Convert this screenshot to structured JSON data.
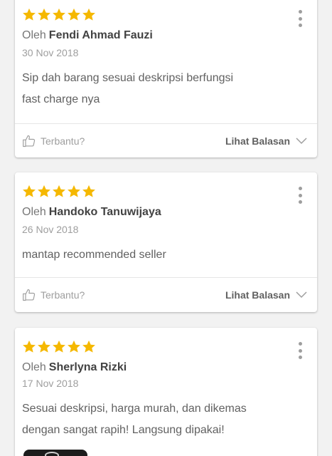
{
  "reviews": [
    {
      "rating": 5,
      "by_prefix": "Oleh",
      "reviewer": "Fendi Ahmad Fauzi",
      "date": "30 Nov 2018",
      "text_lines": [
        "Sip dah barang sesuai deskripsi berfungsi",
        "fast charge nya"
      ],
      "helpful_label": "Terbantu?",
      "replies_label": "Lihat Balasan"
    },
    {
      "rating": 5,
      "by_prefix": "Oleh",
      "reviewer": "Handoko Tanuwijaya",
      "date": "26 Nov 2018",
      "text_lines": [
        "mantap recommended seller"
      ],
      "helpful_label": "Terbantu?",
      "replies_label": "Lihat Balasan"
    },
    {
      "rating": 5,
      "by_prefix": "Oleh",
      "reviewer": "Sherlyna Rizki",
      "date": "17 Nov 2018",
      "text_lines": [
        "Sesuai deskripsi, harga murah, dan dikemas",
        "dengan sangat rapih! Langsung dipakai!"
      ]
    }
  ],
  "icons": {
    "star": "star-icon",
    "more": "more-vertical-icon",
    "helpful": "thumbs-up-icon",
    "replies": "chevron-down-icon"
  },
  "colors": {
    "star": "#f5b800",
    "reviewer_name": "#424242",
    "muted": "#9e9e9e"
  }
}
